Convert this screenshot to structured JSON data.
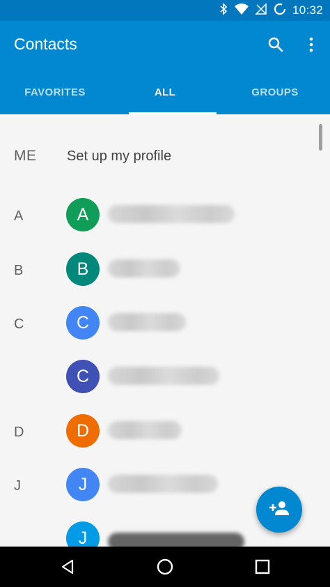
{
  "status_bar": {
    "time": "10:32",
    "icons": [
      "bluetooth-icon",
      "wifi-icon",
      "no-signal-icon",
      "sync-icon"
    ]
  },
  "app_bar": {
    "title": "Contacts",
    "actions": [
      "search-icon",
      "more-vert-icon"
    ]
  },
  "tabs": [
    {
      "label": "FAVORITES",
      "active": false
    },
    {
      "label": "ALL",
      "active": true
    },
    {
      "label": "GROUPS",
      "active": false
    }
  ],
  "me": {
    "label": "ME",
    "text": "Set up my profile"
  },
  "contacts": [
    {
      "section": "A",
      "initial": "A",
      "color": "#0f9d58"
    },
    {
      "section": "B",
      "initial": "B",
      "color": "#00897b"
    },
    {
      "section": "C",
      "initial": "C",
      "color": "#4285f4"
    },
    {
      "section": "",
      "initial": "C",
      "color": "#3f51b5"
    },
    {
      "section": "D",
      "initial": "D",
      "color": "#ef6c00"
    },
    {
      "section": "J",
      "initial": "J",
      "color": "#4285f4"
    },
    {
      "section": "",
      "initial": "J",
      "color": "#039be5"
    }
  ],
  "fab": {
    "icon": "add-person-icon"
  },
  "nav_bar": {
    "buttons": [
      "back-icon",
      "home-icon",
      "recents-icon"
    ]
  },
  "colors": {
    "primary": "#0288d1",
    "primary_dark": "#0277bd"
  }
}
